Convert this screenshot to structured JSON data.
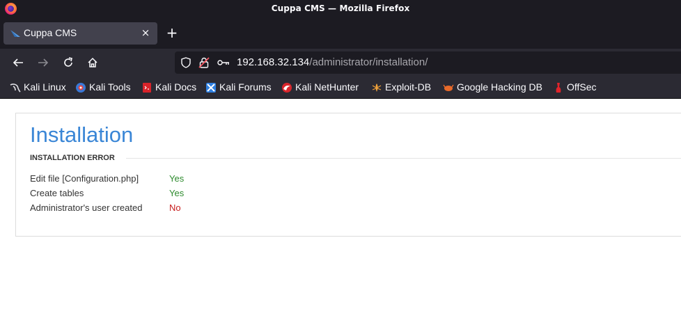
{
  "window": {
    "title": "Cuppa CMS — Mozilla Firefox"
  },
  "tabs": [
    {
      "label": "Cuppa CMS",
      "close": "×"
    }
  ],
  "new_tab_label": "+",
  "urlbar": {
    "host": "192.168.32.134",
    "path": "/administrator/installation/"
  },
  "bookmarks": [
    {
      "label": "Kali Linux",
      "icon": "kali-dragon-icon"
    },
    {
      "label": "Kali Tools",
      "icon": "kali-tools-icon"
    },
    {
      "label": "Kali Docs",
      "icon": "kali-docs-icon"
    },
    {
      "label": "Kali Forums",
      "icon": "kali-forums-icon"
    },
    {
      "label": "Kali NetHunter",
      "icon": "nethunter-icon"
    },
    {
      "label": "Exploit-DB",
      "icon": "exploit-db-icon"
    },
    {
      "label": "Google Hacking DB",
      "icon": "ghdb-icon"
    },
    {
      "label": "OffSec",
      "icon": "offsec-icon"
    }
  ],
  "page": {
    "heading": "Installation",
    "subheading": "INSTALLATION ERROR",
    "rows": [
      {
        "label": "Edit file [Configuration.php]",
        "value": "Yes",
        "status": "ok"
      },
      {
        "label": "Create tables",
        "value": "Yes",
        "status": "ok"
      },
      {
        "label": "Administrator's user created",
        "value": "No",
        "status": "error"
      }
    ]
  },
  "colors": {
    "ok": "#2e8b2e",
    "error": "#c81e1e",
    "heading": "#3a86d6",
    "chrome_dark": "#1c1b22",
    "chrome": "#2b2a33"
  }
}
